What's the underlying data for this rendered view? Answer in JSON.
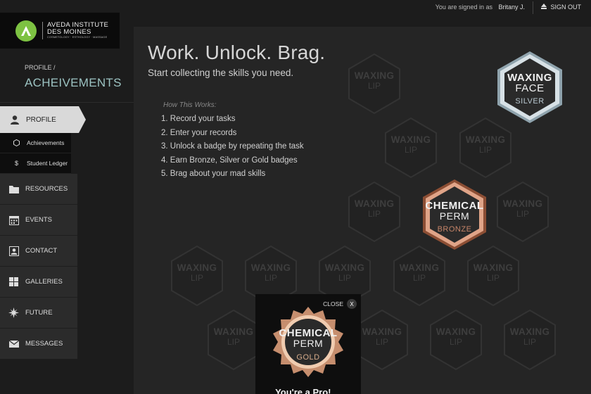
{
  "topbar": {
    "signed_in_label": "You are signed in as",
    "user_name": "Britany J.",
    "sign_out_label": "SIGN OUT"
  },
  "logo": {
    "line1": "AVEDA INSTITUTE",
    "line2": "DES MOINES",
    "line3": "COSMETOLOGY · ESTHOLOGY · MASSAGE"
  },
  "sidebar": {
    "breadcrumb": "PROFILE /",
    "title": "ACHEIVEMENTS",
    "profile_label": "PROFILE",
    "sub_items": [
      {
        "label": "Achievements",
        "icon": "hexagon-icon"
      },
      {
        "label": "Student Ledger",
        "icon": "dollar-icon"
      }
    ],
    "items": [
      {
        "label": "RESOURCES",
        "icon": "folder-icon"
      },
      {
        "label": "EVENTS",
        "icon": "calendar-icon"
      },
      {
        "label": "CONTACT",
        "icon": "contact-card-icon"
      },
      {
        "label": "GALLERIES",
        "icon": "grid-icon"
      },
      {
        "label": "FUTURE",
        "icon": "star-burst-icon"
      },
      {
        "label": "MESSAGES",
        "icon": "envelope-icon"
      }
    ]
  },
  "main": {
    "headline": "Work. Unlock. Brag.",
    "subheadline": "Start collecting the skills you need.",
    "how_title": "How This Works:",
    "steps": [
      "1. Record your tasks",
      "2. Enter your records",
      "3. Unlock a badge by repeating the task",
      "4. Earn Bronze, Silver or Gold badges",
      "5. Brag about your mad skills"
    ],
    "locked_label_1": "WAXING",
    "locked_label_2": "LIP"
  },
  "badges": {
    "silver": {
      "line1": "WAXING",
      "line2": "FACE",
      "tier": "SILVER"
    },
    "bronze": {
      "line1": "CHEMICAL",
      "line2": "PERM",
      "tier": "BRONZE"
    },
    "gold": {
      "line1": "CHEMICAL",
      "line2": "PERM",
      "tier": "GOLD"
    }
  },
  "popup": {
    "close_label": "CLOSE",
    "close_x": "X",
    "message": "You're a Pro! ..."
  },
  "colors": {
    "accent_teal": "#9cc3c2",
    "logo_green": "#7dc242",
    "silver": "#b9c8d0",
    "bronze": "#c58468",
    "gold": "#d6ab8a"
  }
}
